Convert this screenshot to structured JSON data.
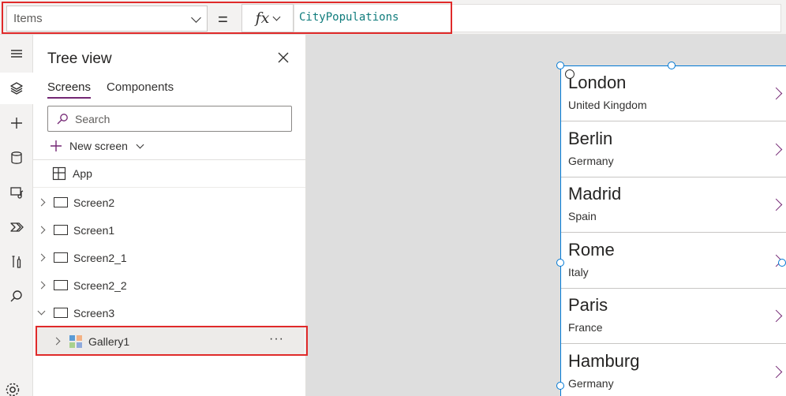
{
  "formula_bar": {
    "property": "Items",
    "equals": "=",
    "fx_label": "fx",
    "formula": "CityPopulations"
  },
  "rail": {
    "items": [
      "hamburger-icon",
      "layers-icon",
      "insert-icon",
      "data-icon",
      "media-icon",
      "power-automate-icon",
      "tools-icon",
      "search-icon"
    ],
    "active": "layers-icon"
  },
  "tree_view": {
    "title": "Tree view",
    "tabs": [
      {
        "label": "Screens",
        "selected": true
      },
      {
        "label": "Components",
        "selected": false
      }
    ],
    "search_placeholder": "Search",
    "new_screen_label": "New screen",
    "app_label": "App",
    "nodes": [
      {
        "label": "Screen2",
        "expanded": false
      },
      {
        "label": "Screen1",
        "expanded": false
      },
      {
        "label": "Screen2_1",
        "expanded": false
      },
      {
        "label": "Screen2_2",
        "expanded": false
      },
      {
        "label": "Screen3",
        "expanded": true
      }
    ],
    "selected_child": {
      "label": "Gallery1",
      "more": "···"
    }
  },
  "gallery": {
    "items": [
      {
        "city": "London",
        "country": "United Kingdom"
      },
      {
        "city": "Berlin",
        "country": "Germany"
      },
      {
        "city": "Madrid",
        "country": "Spain"
      },
      {
        "city": "Rome",
        "country": "Italy"
      },
      {
        "city": "Paris",
        "country": "France"
      },
      {
        "city": "Hamburg",
        "country": "Germany"
      }
    ]
  },
  "colors": {
    "accent": "#742774",
    "selection": "#0078d4",
    "highlight": "#e02a2a",
    "formula_text": "#107c7c"
  }
}
